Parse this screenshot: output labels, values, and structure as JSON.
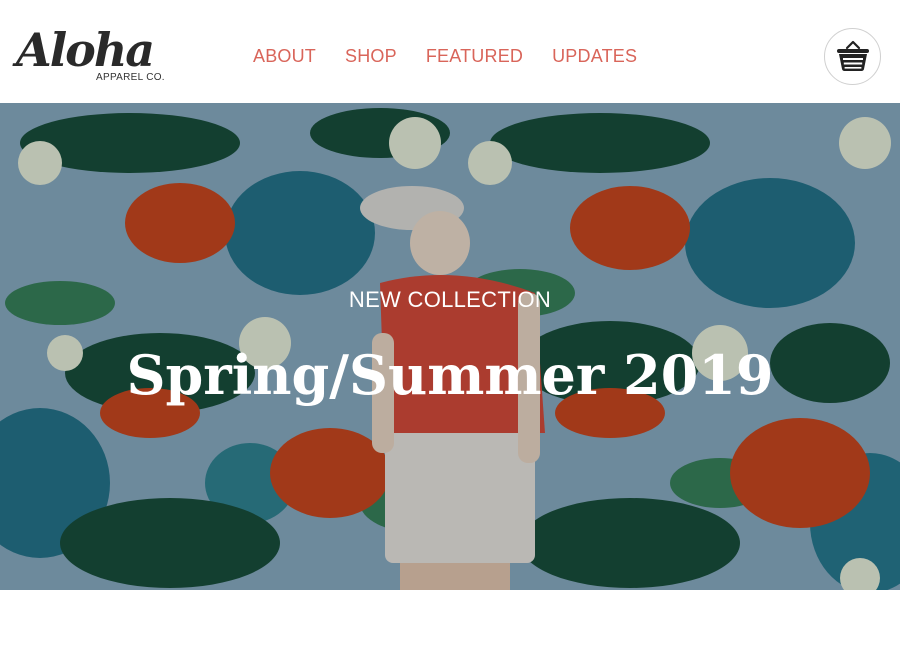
{
  "brand": {
    "logo_text": "Aloha",
    "logo_sub": "APPAREL CO."
  },
  "nav": {
    "items": [
      {
        "label": "ABOUT"
      },
      {
        "label": "SHOP"
      },
      {
        "label": "FEATURED"
      },
      {
        "label": "UPDATES"
      }
    ],
    "color": "#d9655a"
  },
  "cart": {
    "icon": "basket-icon"
  },
  "hero": {
    "kicker": "NEW COLLECTION",
    "title": "Spring/Summer 2019",
    "background_color": "#7fa2b8"
  }
}
